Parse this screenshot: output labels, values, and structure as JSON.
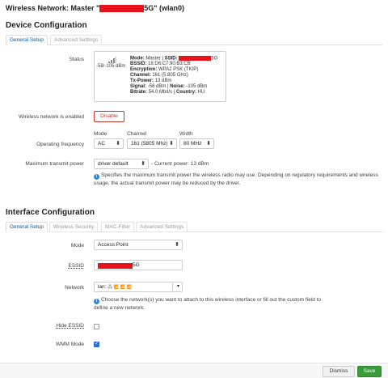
{
  "title": {
    "prefix": "Wireless Network: Master \"",
    "suffix": "5G\" (wlan0)"
  },
  "device": {
    "heading": "Device Configuration",
    "tabs": [
      "General Setup",
      "Advanced Settings"
    ],
    "status_label": "Status",
    "status": {
      "signal_text": "-58/-105 dBm",
      "mode_label": "Mode:",
      "mode": "Master",
      "ssid_label": "SSID:",
      "ssid_suffix": "5G",
      "bssid_label": "BSSID:",
      "bssid": "18:D6:C7:90:B3:CB",
      "enc_label": "Encryption:",
      "encryption": "WPA2 PSK (TKIP)",
      "channel_label": "Channel:",
      "channel": "161 (5.805 GHz)",
      "txpower_label": "Tx-Power:",
      "txpower": "13 dBm",
      "signal_label": "Signal:",
      "signal": "-58 dBm",
      "noise_label": "Noise:",
      "noise": "-105 dBm",
      "bitrate_label": "Bitrate:",
      "bitrate": "54.0 Mbit/s",
      "country_label": "Country:",
      "country": "HU"
    },
    "enabled_label": "Wireless network is enabled",
    "disable_button": "Disable",
    "freq_label": "Operating frequency",
    "mode_col": "Mode",
    "channel_col": "Channel",
    "width_col": "Width",
    "mode_value": "AC",
    "channel_value": "161 (5805 Mhz)",
    "width_value": "80 MHz",
    "txpower_label": "Maximum transmit power",
    "txpower_value": "driver default",
    "current_power": "- Current power: 13 dBm",
    "txpower_note": "Specifies the maximum transmit power the wireless radio may use. Depending on regulatory requirements and wireless usage, the actual transmit power may be reduced by the driver."
  },
  "iface": {
    "heading": "Interface Configuration",
    "tabs": [
      "General Setup",
      "Wireless Security",
      "MAC-Filter",
      "Advanced Settings"
    ],
    "mode_label": "Mode",
    "mode_value": "Access Point",
    "essid_label": "ESSID",
    "essid_suffix": "5G",
    "network_label": "Network",
    "network_value": "lan:",
    "network_note": "Choose the network(s) you want to attach to this wireless interface or fill out the custom field to define a new network.",
    "hide_essid_label": "Hide ESSID",
    "hide_essid": false,
    "wmm_label": "WMM Mode",
    "wmm": true
  },
  "footer": {
    "dismiss": "Dismiss",
    "save": "Save"
  },
  "colors": {
    "redact": "#e8121b",
    "link": "#005aab",
    "save": "#3a9b3a",
    "disable_border": "#c0392b"
  }
}
